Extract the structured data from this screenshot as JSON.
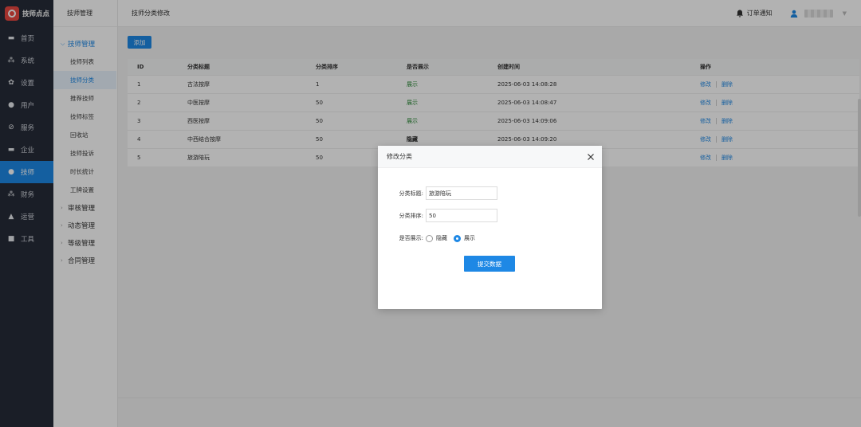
{
  "app": {
    "logo_text": "技师点点"
  },
  "nav": {
    "items": [
      {
        "label": "首页",
        "icon": "monitor-icon",
        "glyph": "▬"
      },
      {
        "label": "系统",
        "icon": "sitemap-icon",
        "glyph": "⁂"
      },
      {
        "label": "设置",
        "icon": "gear-icon",
        "glyph": "✿"
      },
      {
        "label": "用户",
        "icon": "user-icon",
        "glyph": "●"
      },
      {
        "label": "服务",
        "icon": "link-icon",
        "glyph": "⊘"
      },
      {
        "label": "企业",
        "icon": "card-icon",
        "glyph": "▬"
      },
      {
        "label": "技师",
        "icon": "user-icon",
        "glyph": "●"
      },
      {
        "label": "财务",
        "icon": "sitemap-icon",
        "glyph": "⁂"
      },
      {
        "label": "运营",
        "icon": "chart-icon",
        "glyph": "▲"
      },
      {
        "label": "工具",
        "icon": "briefcase-icon",
        "glyph": "■"
      }
    ],
    "active_index": 6
  },
  "subnav": {
    "header": "技师管理",
    "open_group": "技师管理",
    "children": [
      "技师列表",
      "技师分类",
      "推荐技师",
      "技师标签",
      "回收站",
      "技师投诉",
      "时长统计",
      "工牌设置"
    ],
    "active_child": 1,
    "groups": [
      "审核管理",
      "动态管理",
      "等级管理",
      "合同管理"
    ]
  },
  "topbar": {
    "breadcrumb": "技师分类修改",
    "notify_label": "订单通知"
  },
  "toolbar": {
    "add_label": "添加"
  },
  "table": {
    "headers": [
      "ID",
      "分类标题",
      "分类排序",
      "是否展示",
      "创建时间",
      "操作"
    ],
    "rows": [
      {
        "id": "1",
        "title": "古法按摩",
        "sort": "1",
        "show": "展示",
        "show_state": "yes",
        "created": "2025-06-03 14:08:28"
      },
      {
        "id": "2",
        "title": "中医按摩",
        "sort": "50",
        "show": "展示",
        "show_state": "yes",
        "created": "2025-06-03 14:08:47"
      },
      {
        "id": "3",
        "title": "西医按摩",
        "sort": "50",
        "show": "展示",
        "show_state": "yes",
        "created": "2025-06-03 14:09:06"
      },
      {
        "id": "4",
        "title": "中西结合按摩",
        "sort": "50",
        "show": "隐藏",
        "show_state": "no",
        "created": "2025-06-03 14:09:20"
      },
      {
        "id": "5",
        "title": "旅游陪玩",
        "sort": "50",
        "show": "",
        "show_state": "",
        "created": ""
      }
    ],
    "edit_label": "修改",
    "delete_label": "删除"
  },
  "modal": {
    "title": "修改分类",
    "title_label": "分类标题:",
    "title_value": "旅游陪玩",
    "sort_label": "分类排序:",
    "sort_value": "50",
    "show_label": "是否展示:",
    "option_hide": "隐藏",
    "option_show": "展示",
    "selected": "展示",
    "submit_label": "提交数据"
  },
  "colors": {
    "accent": "#1e88e5",
    "nav_bg": "#262c38",
    "show_yes": "#2e8b3a",
    "logo": "#e9473f"
  }
}
